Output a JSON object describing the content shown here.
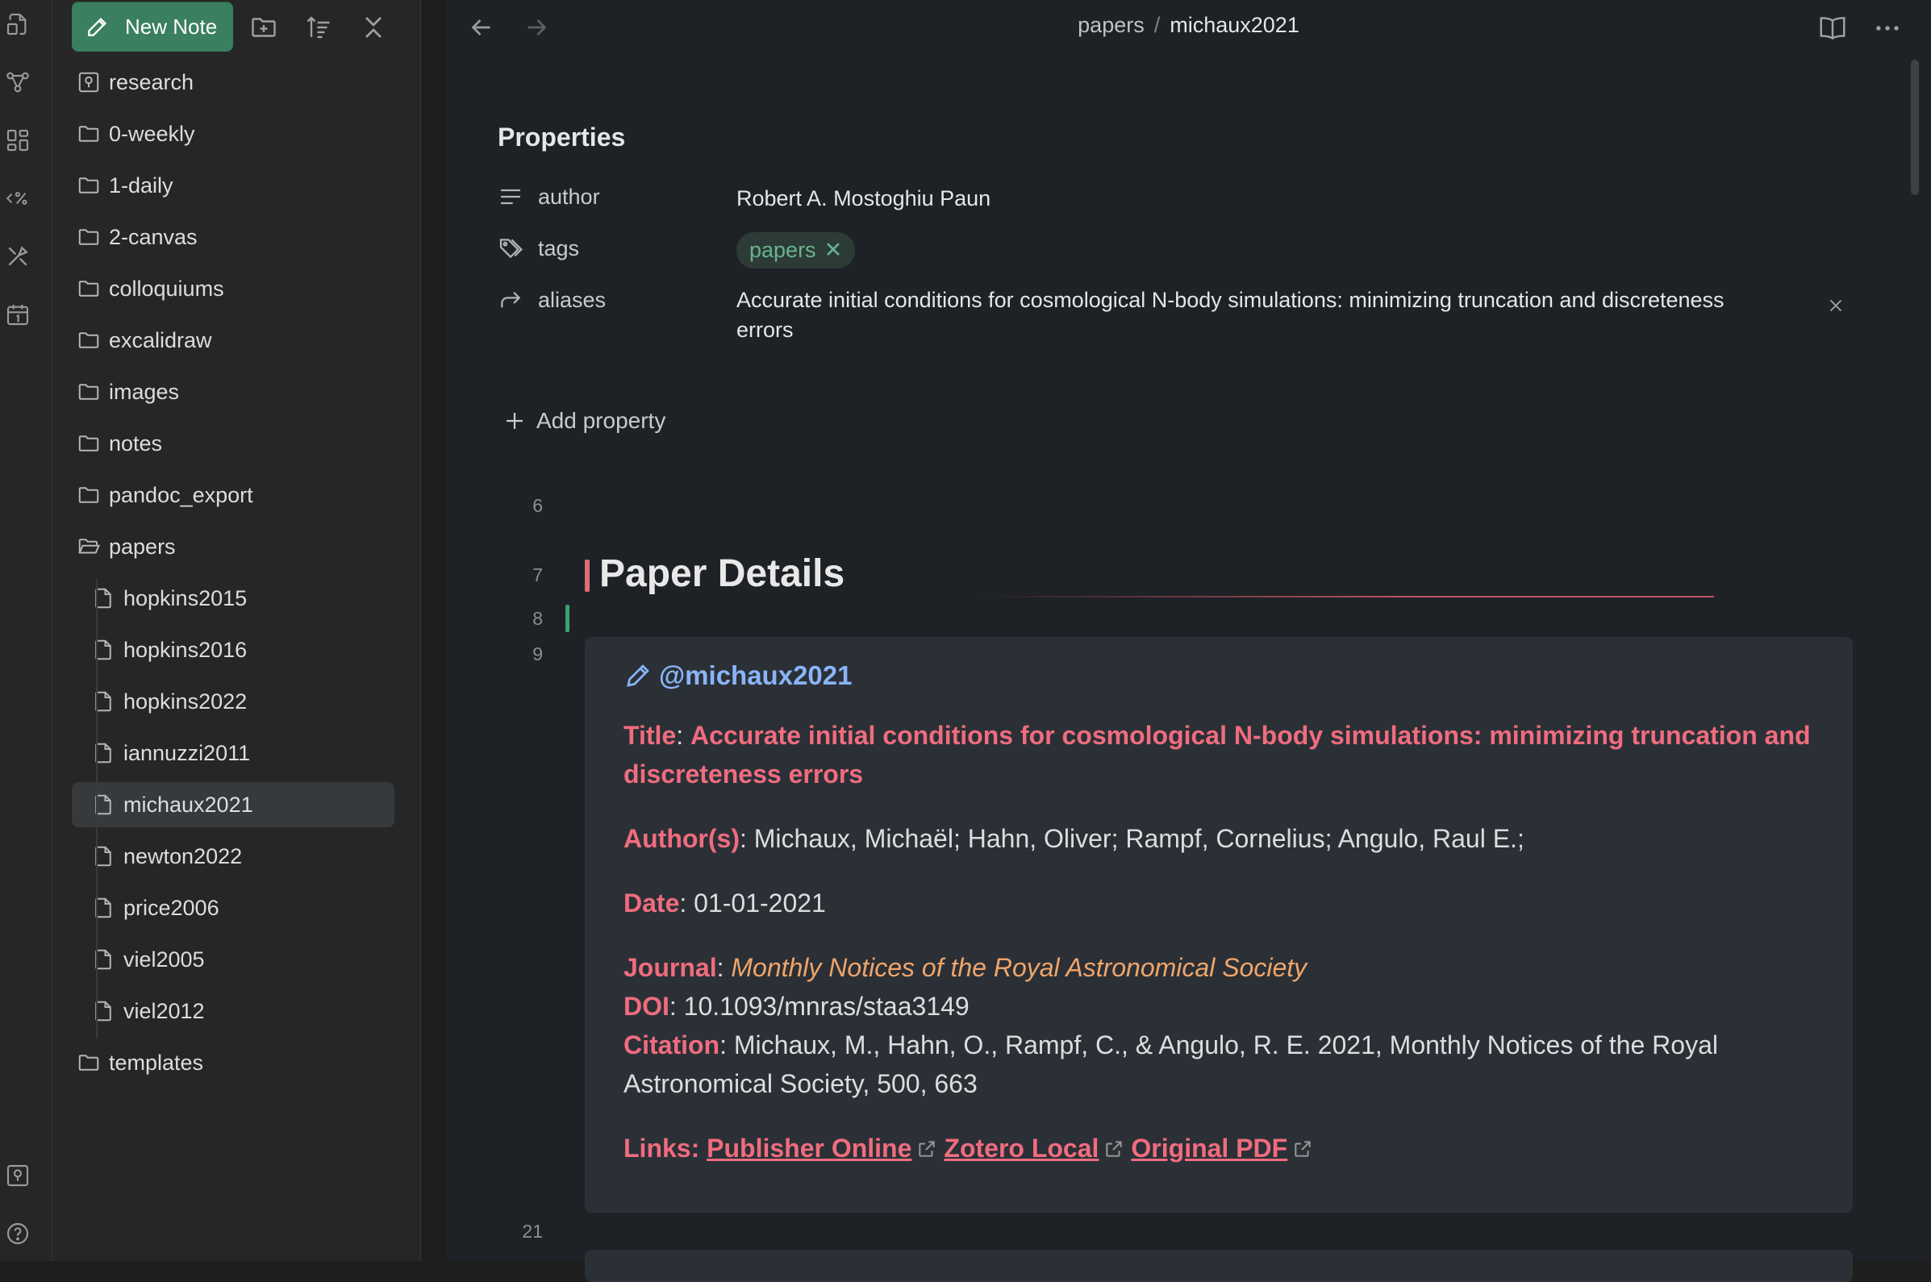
{
  "ribbon": {
    "icons": [
      "files-icon",
      "graph-icon",
      "dashboard-icon",
      "templater-icon",
      "excalidraw-icon",
      "calendar-icon",
      "vault-icon",
      "help-icon"
    ]
  },
  "sidebar": {
    "new_note_label": "New Note",
    "tree": [
      {
        "label": "research",
        "type": "vault"
      },
      {
        "label": "0-weekly",
        "type": "folder"
      },
      {
        "label": "1-daily",
        "type": "folder"
      },
      {
        "label": "2-canvas",
        "type": "folder"
      },
      {
        "label": "colloquiums",
        "type": "folder"
      },
      {
        "label": "excalidraw",
        "type": "folder"
      },
      {
        "label": "images",
        "type": "folder"
      },
      {
        "label": "notes",
        "type": "folder"
      },
      {
        "label": "pandoc_export",
        "type": "folder"
      },
      {
        "label": "papers",
        "type": "folder-open"
      },
      {
        "label": "hopkins2015",
        "type": "file"
      },
      {
        "label": "hopkins2016",
        "type": "file"
      },
      {
        "label": "hopkins2022",
        "type": "file"
      },
      {
        "label": "iannuzzi2011",
        "type": "file"
      },
      {
        "label": "michaux2021",
        "type": "file",
        "active": true
      },
      {
        "label": "newton2022",
        "type": "file"
      },
      {
        "label": "price2006",
        "type": "file"
      },
      {
        "label": "viel2005",
        "type": "file"
      },
      {
        "label": "viel2012",
        "type": "file"
      },
      {
        "label": "templates",
        "type": "folder"
      }
    ]
  },
  "main": {
    "breadcrumb": {
      "folder": "papers",
      "separator": "/",
      "file": "michaux2021"
    },
    "properties": {
      "title": "Properties",
      "author_key": "author",
      "author_value": "Robert A. Mostoghiu Paun",
      "tags_key": "tags",
      "tag_value": "papers",
      "tag_remove": "✕",
      "aliases_key": "aliases",
      "aliases_value": "Accurate initial conditions for cosmological N-body simulations: minimizing truncation and discreteness errors",
      "add_label": "Add property"
    },
    "lines": {
      "l6": "6",
      "l7": "7",
      "l8": "8",
      "l9": "9",
      "l21": "21"
    },
    "heading": "Paper Details",
    "callout": {
      "citekey": "@michaux2021",
      "title_key": "Title",
      "title_value": "Accurate initial conditions for cosmological N-body simulations: minimizing truncation and discreteness errors",
      "authors_key": "Author(s)",
      "authors_value": "Michaux, Michaël; Hahn, Oliver; Rampf, Cornelius; Angulo, Raul E.;",
      "date_key": "Date",
      "date_value": "01-01-2021",
      "journal_key": "Journal",
      "journal_value": "Monthly Notices of the Royal Astronomical Society",
      "doi_key": "DOI",
      "doi_value": "10.1093/mnras/staa3149",
      "citation_key": "Citation",
      "citation_value": "Michaux, M., Hahn, O., Rampf, C., & Angulo, R. E. 2021, Monthly Notices of the Royal Astronomical Society, 500, 663",
      "links_key": "Links:",
      "link1": "Publisher Online",
      "link2": "Zotero Local",
      "link3": "Original PDF"
    }
  },
  "colors": {
    "accent": "#3a7f5f",
    "heading_accent": "#e06c7a",
    "callout_key": "#f06c7e",
    "journal": "#f0a56a",
    "citekey": "#8ab4f8"
  }
}
